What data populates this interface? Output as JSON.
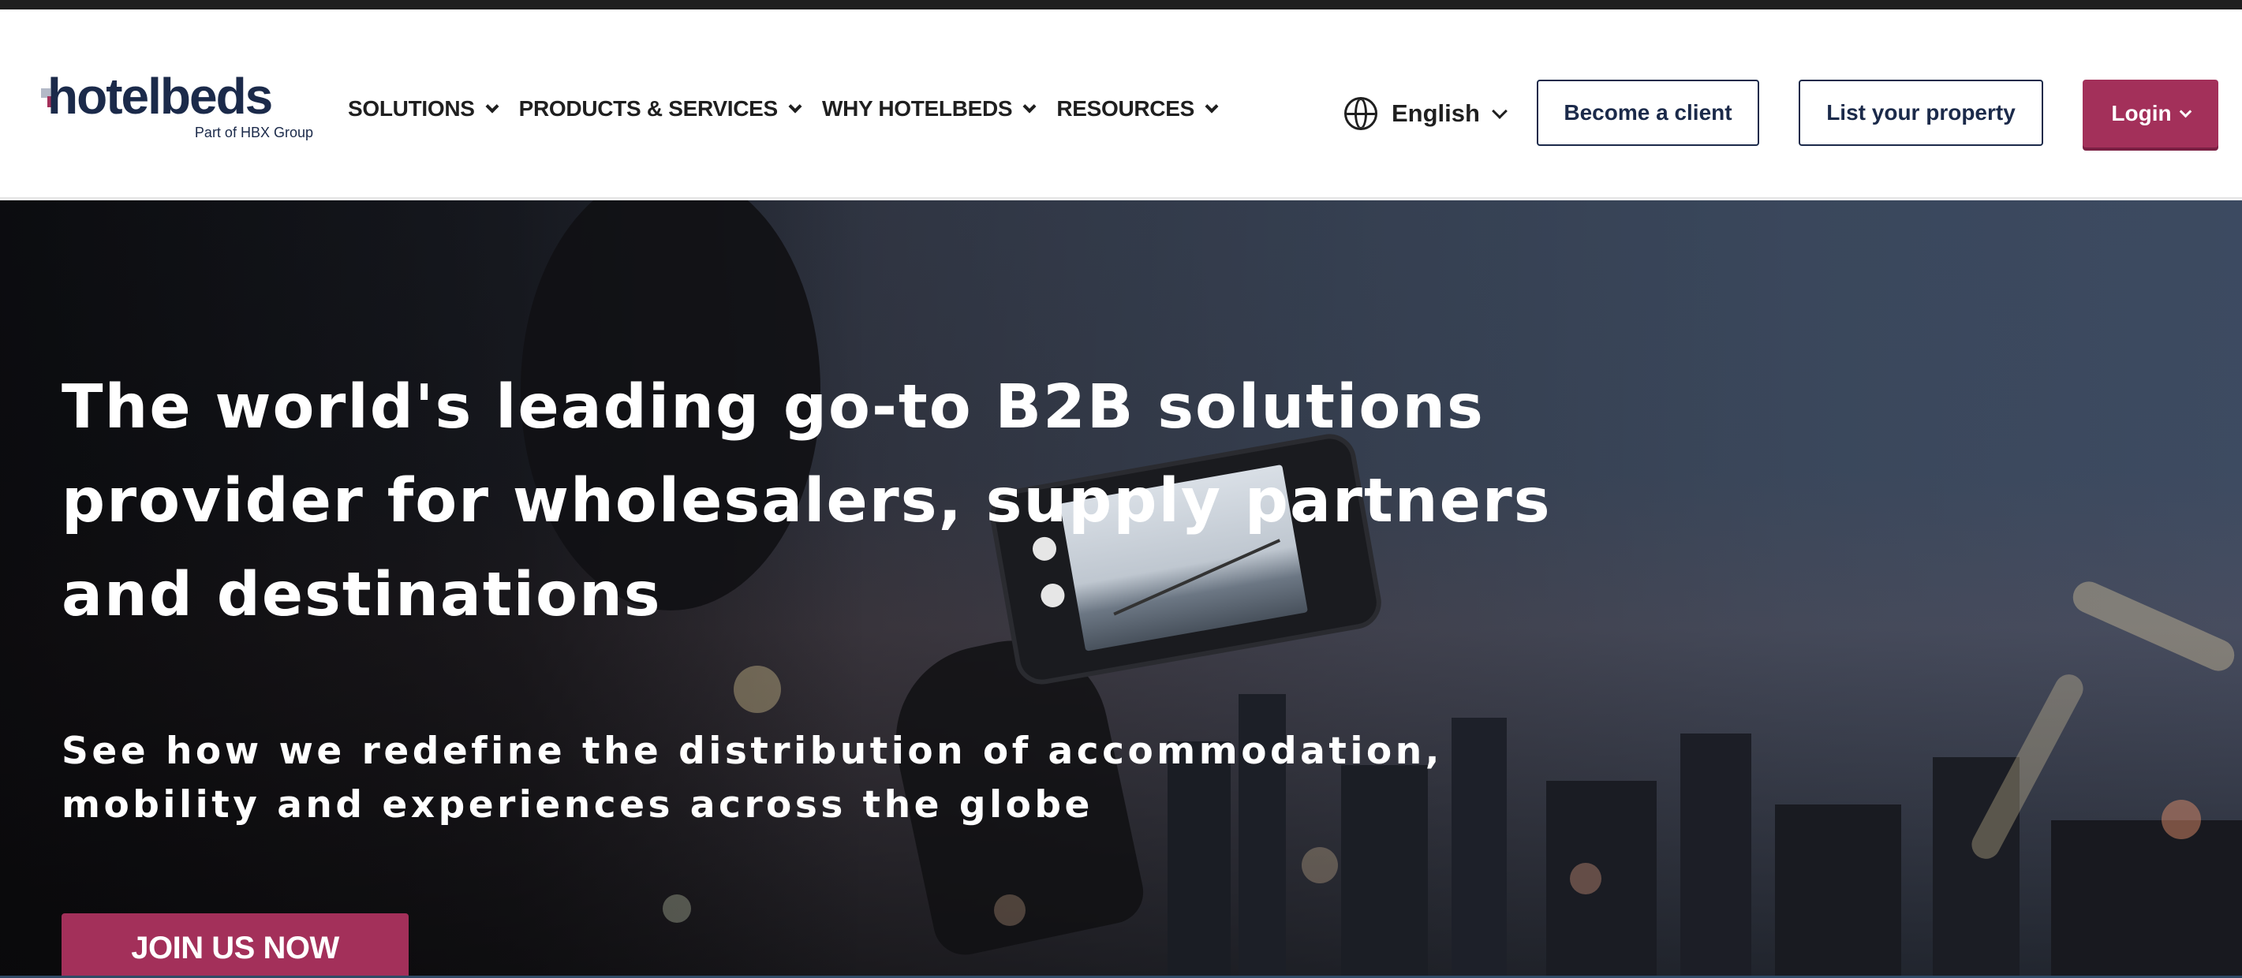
{
  "header": {
    "logo": {
      "wordmark": "hotelbeds",
      "tagline": "Part of HBX Group"
    },
    "nav": [
      {
        "label": "SOLUTIONS",
        "icon": "chevron-down-icon"
      },
      {
        "label": "PRODUCTS & SERVICES",
        "icon": "chevron-down-icon"
      },
      {
        "label": "WHY HOTELBEDS",
        "icon": "chevron-down-icon"
      },
      {
        "label": "RESOURCES",
        "icon": "chevron-down-icon"
      }
    ],
    "language": {
      "label": "English",
      "icon": "globe-icon"
    },
    "buttons": {
      "become_client": "Become a client",
      "list_property": "List your property",
      "login": "Login"
    }
  },
  "hero": {
    "title": "The world's leading go-to B2B solutions provider for wholesalers, supply partners and destinations",
    "subtitle": "See how we redefine the distribution of accommodation, mobility and experiences across the globe",
    "cta": "JOIN US NOW"
  },
  "colors": {
    "brand_navy": "#1b2a4a",
    "brand_magenta": "#a3305a",
    "text_dark": "#1f1f1f",
    "white": "#ffffff"
  }
}
